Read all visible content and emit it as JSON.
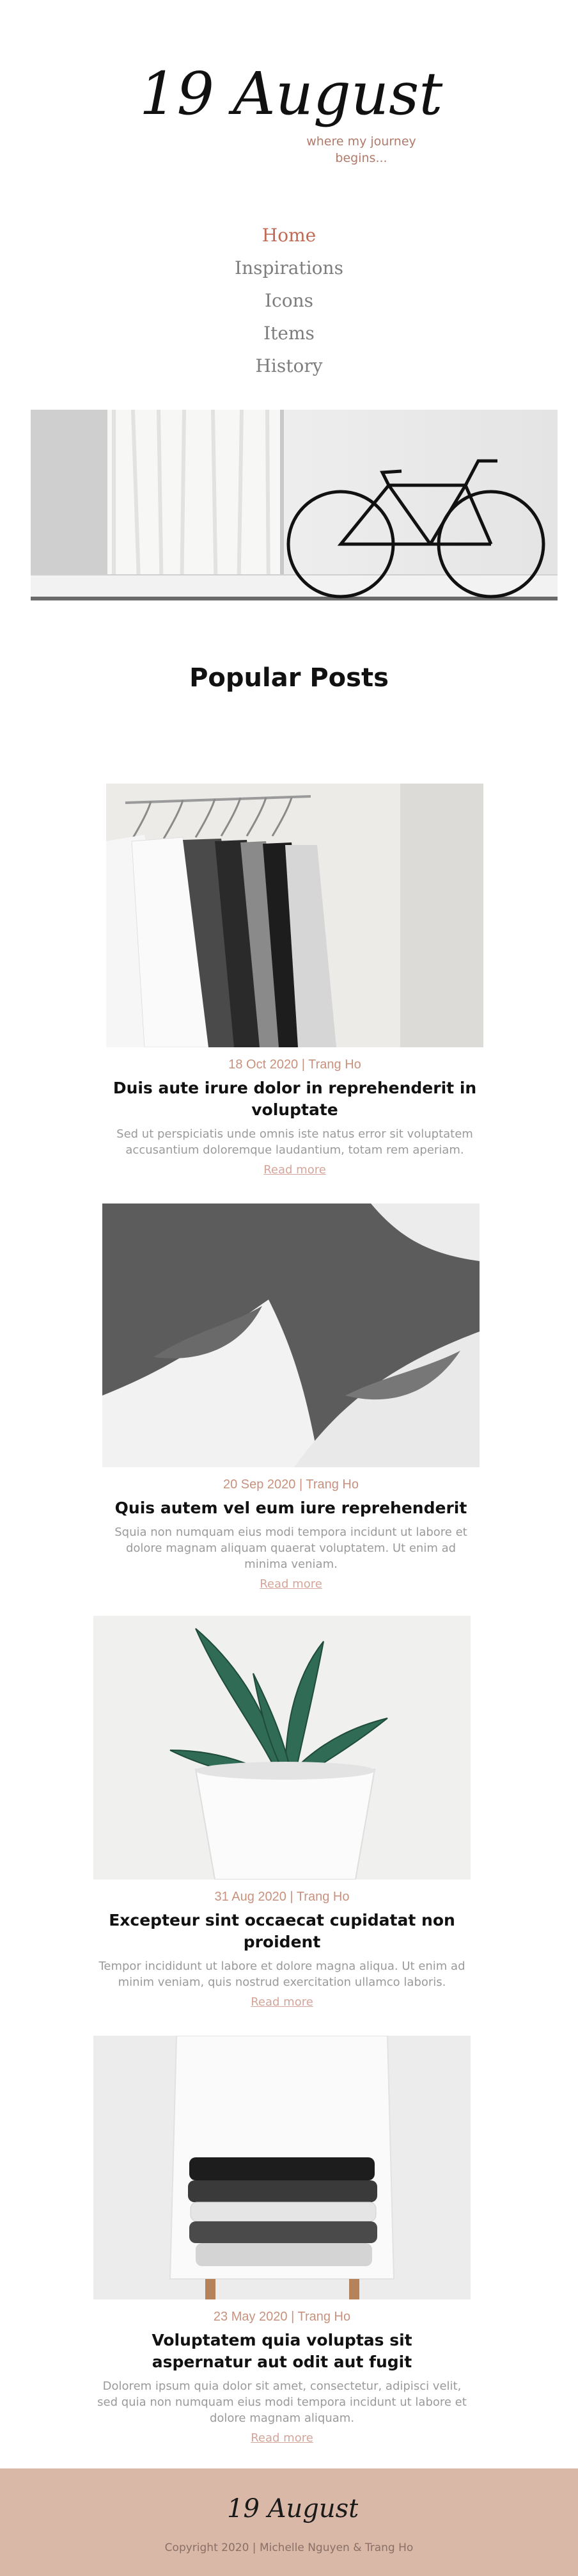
{
  "brand": {
    "logo_text": "19 August",
    "tagline_line1": "where my journey",
    "tagline_line2": "begins..."
  },
  "nav": {
    "items": [
      {
        "label": "Home",
        "active": true
      },
      {
        "label": "Inspirations",
        "active": false
      },
      {
        "label": "Icons",
        "active": false
      },
      {
        "label": "Items",
        "active": false
      },
      {
        "label": "History",
        "active": false
      }
    ]
  },
  "main": {
    "section_title": "Popular Posts",
    "posts": [
      {
        "meta": "18 Oct 2020 | Trang Ho",
        "title": "Duis aute irure dolor in reprehenderit in voluptate",
        "excerpt": "Sed ut perspiciatis unde omnis iste natus error sit voluptatem accusantium doloremque laudantium, totam rem aperiam.",
        "read_more": "Read more"
      },
      {
        "meta": "20 Sep 2020 | Trang Ho",
        "title": "Quis autem vel eum iure reprehenderit",
        "excerpt": "Squia non numquam eius modi tempora incidunt ut labore et dolore magnam aliquam quaerat voluptatem. Ut enim ad minima veniam.",
        "read_more": "Read more"
      },
      {
        "meta": "31 Aug 2020 | Trang Ho",
        "title": "Excepteur sint occaecat cupidatat non proident",
        "excerpt": "Tempor incididunt ut labore et dolore magna aliqua. Ut enim ad minim veniam, quis nostrud exercitation ullamco laboris.",
        "read_more": "Read more"
      },
      {
        "meta": "23 May 2020 | Trang Ho",
        "title": "Voluptatem quia voluptas sit aspernatur aut odit aut fugit",
        "excerpt": "Dolorem ipsum quia dolor sit amet, consectetur, adipisci velit, sed quia non numquam eius modi tempora incidunt ut labore et dolore magnam aliquam.",
        "read_more": "Read more"
      }
    ]
  },
  "footer": {
    "logo_text": "19 August",
    "copyright": "Copyright 2020 | Michelle Nguyen & Trang Ho"
  },
  "colors": {
    "accent": "#c16a55",
    "meta": "#c8917e",
    "footer_bg": "#d9b8a8"
  }
}
